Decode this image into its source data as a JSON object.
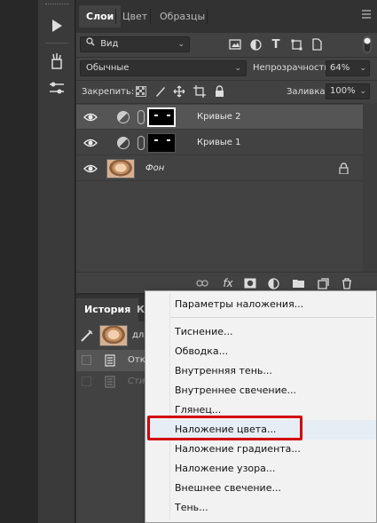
{
  "layers_panel": {
    "tabs": [
      "Слои",
      "Цвет",
      "Образцы"
    ],
    "filter_kind": "Вид",
    "blend_mode": "Обычные",
    "opacity_label": "Непрозрачность:",
    "opacity_value": "64%",
    "lock_label": "Закрепить:",
    "fill_label": "Заливка:",
    "fill_value": "100%",
    "layers": [
      {
        "name": "Кривые 2",
        "selected": true
      },
      {
        "name": "Кривые 1",
        "selected": false
      },
      {
        "name": "Фон",
        "selected": false
      }
    ],
    "bottom_fx": "fx"
  },
  "history_panel": {
    "tabs": [
      "История",
      "К"
    ],
    "snapshot_label": "дл",
    "rows": [
      "Отк",
      "Сти"
    ]
  },
  "context_menu": {
    "items": [
      "Параметры наложения...",
      "Тиснение...",
      "Обводка...",
      "Внутренняя тень...",
      "Внутреннее свечение...",
      "Глянец...",
      "Наложение цвета...",
      "Наложение градиента...",
      "Наложение узора...",
      "Внешнее свечение...",
      "Тень..."
    ],
    "highlighted_item": "Наложение цвета...",
    "highlight_color": "#d10000"
  },
  "icons": [
    "play-icon",
    "brushes-icon",
    "adjustments-icon",
    "eye-icon",
    "link-icon",
    "fx-icon",
    "mask-icon",
    "adjustment-layer-icon",
    "folder-icon",
    "new-layer-icon",
    "trash-icon",
    "lock-icon"
  ]
}
